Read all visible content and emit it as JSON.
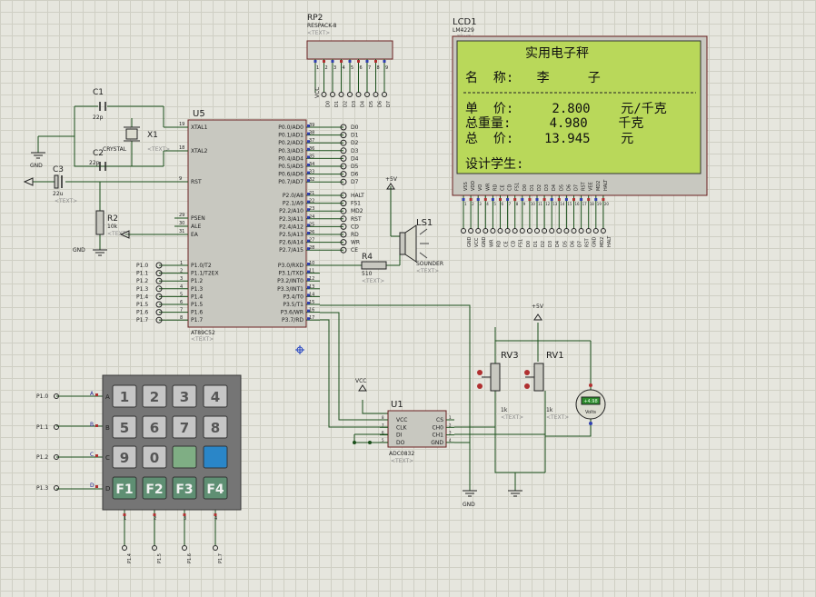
{
  "u5": {
    "ref": "U5",
    "part": "AT89C52",
    "text": "<TEXT>",
    "left_pins": [
      {
        "num": "19",
        "name": "XTAL1"
      },
      {
        "num": "18",
        "name": "XTAL2"
      },
      {
        "num": "9",
        "name": "RST"
      },
      {
        "num": "29",
        "name": "PSEN"
      },
      {
        "num": "30",
        "name": "ALE"
      },
      {
        "num": "31",
        "name": "EA"
      }
    ],
    "p1_pins": [
      {
        "num": "1",
        "name": "P1.0/T2",
        "net": "P1.0"
      },
      {
        "num": "2",
        "name": "P1.1/T2EX",
        "net": "P1.1"
      },
      {
        "num": "3",
        "name": "P1.2",
        "net": "P1.2"
      },
      {
        "num": "4",
        "name": "P1.3",
        "net": "P1.3"
      },
      {
        "num": "5",
        "name": "P1.4",
        "net": "P1.4"
      },
      {
        "num": "6",
        "name": "P1.5",
        "net": "P1.5"
      },
      {
        "num": "7",
        "name": "P1.6",
        "net": "P1.6"
      },
      {
        "num": "8",
        "name": "P1.7",
        "net": "P1.7"
      }
    ],
    "p0_pins": [
      {
        "num": "39",
        "name": "P0.0/AD0",
        "net": "D0"
      },
      {
        "num": "38",
        "name": "P0.1/AD1",
        "net": "D1"
      },
      {
        "num": "37",
        "name": "P0.2/AD2",
        "net": "D2"
      },
      {
        "num": "36",
        "name": "P0.3/AD3",
        "net": "D3"
      },
      {
        "num": "35",
        "name": "P0.4/AD4",
        "net": "D4"
      },
      {
        "num": "34",
        "name": "P0.5/AD5",
        "net": "D5"
      },
      {
        "num": "33",
        "name": "P0.6/AD6",
        "net": "D6"
      },
      {
        "num": "32",
        "name": "P0.7/AD7",
        "net": "D7"
      }
    ],
    "p2_pins": [
      {
        "num": "21",
        "name": "P2.0/A8",
        "net": "HALT"
      },
      {
        "num": "22",
        "name": "P2.1/A9",
        "net": "FS1"
      },
      {
        "num": "23",
        "name": "P2.2/A10",
        "net": "MD2"
      },
      {
        "num": "24",
        "name": "P2.3/A11",
        "net": "RST"
      },
      {
        "num": "25",
        "name": "P2.4/A12",
        "net": "CD"
      },
      {
        "num": "26",
        "name": "P2.5/A13",
        "net": "RD"
      },
      {
        "num": "27",
        "name": "P2.6/A14",
        "net": "WR"
      },
      {
        "num": "28",
        "name": "P2.7/A15",
        "net": "CE"
      }
    ],
    "p3_pins": [
      {
        "num": "10",
        "name": "P3.0/RXD"
      },
      {
        "num": "11",
        "name": "P3.1/TXD"
      },
      {
        "num": "12",
        "name": "P3.2/INT0"
      },
      {
        "num": "13",
        "name": "P3.3/INT1"
      },
      {
        "num": "14",
        "name": "P3.4/T0"
      },
      {
        "num": "15",
        "name": "P3.5/T1"
      },
      {
        "num": "16",
        "name": "P3.6/WR"
      },
      {
        "num": "17",
        "name": "P3.7/RD"
      }
    ]
  },
  "parts": {
    "c1": {
      "ref": "C1",
      "value": "22p"
    },
    "c2": {
      "ref": "C2",
      "value": "22p"
    },
    "c3": {
      "ref": "C3",
      "value": "22u"
    },
    "x1": {
      "ref": "X1",
      "value": "CRYSTAL",
      "text": "<TEXT>"
    },
    "r2": {
      "ref": "R2",
      "value": "10k",
      "text": "<TEXT>"
    },
    "r4": {
      "ref": "R4",
      "value": "510",
      "text": "<TEXT>"
    },
    "ls1": {
      "ref": "LS1",
      "value": "SOUNDER",
      "text": "<TEXT>"
    },
    "rp2": {
      "ref": "RP2",
      "value": "RESPACK-8",
      "text": "<TEXT>",
      "vcc": "VCC"
    },
    "u1": {
      "ref": "U1",
      "part": "ADC0832",
      "text": "<TEXT>",
      "left_pins": [
        "VCC",
        "CLK",
        "DI",
        "DO"
      ],
      "left_nums": [
        "8",
        "7",
        "6",
        "5"
      ],
      "right_pins": [
        "CS",
        "CH0",
        "CH1",
        "GND"
      ],
      "right_nums": [
        "1",
        "2",
        "3",
        "4"
      ]
    },
    "rv3": {
      "ref": "RV3",
      "value": "1k",
      "text": "<TEXT>"
    },
    "rv1": {
      "ref": "RV1",
      "value": "1k",
      "text": "<TEXT>"
    },
    "meter": {
      "reading": "+4.98",
      "unit": "Volts"
    },
    "gnd_labels": [
      "GND",
      "GND",
      "GND"
    ],
    "vcc_labels": [
      "+5V",
      "+5V",
      "VCC"
    ]
  },
  "rp2_pins": [
    "1",
    "2",
    "3",
    "4",
    "5",
    "6",
    "7",
    "8",
    "9"
  ],
  "rp2_nets": [
    "D0",
    "D1",
    "D2",
    "D3",
    "D4",
    "D5",
    "D6",
    "D7"
  ],
  "lcd": {
    "ref": "LCD1",
    "part": "LM4229",
    "text": "<TEXT>",
    "bg_color": "#b9d85a",
    "lines": [
      "实用电子秤",
      "名  称:   李     子",
      "单  价:     2.800    元/千克",
      "总重量:     4.980    千克",
      "总  价:    13.945    元",
      "设计学生:"
    ],
    "pins": [
      "VSS",
      "VDD",
      "VO",
      "WR",
      "RD",
      "CE",
      "CD",
      "FS1",
      "D0",
      "D1",
      "D2",
      "D3",
      "D4",
      "D5",
      "D6",
      "D7",
      "RST",
      "VEE",
      "MD2",
      "HALT"
    ],
    "pin_nums": [
      "1",
      "2",
      "3",
      "4",
      "5",
      "6",
      "7",
      "8",
      "9",
      "10",
      "11",
      "12",
      "13",
      "14",
      "15",
      "16",
      "17",
      "18",
      "19",
      "20"
    ],
    "nets": [
      "GND",
      "VCC",
      "GND",
      "WR",
      "RD",
      "CE",
      "CD",
      "FS1",
      "D0",
      "D1",
      "D2",
      "D3",
      "D4",
      "D5",
      "D6",
      "D7",
      "RST",
      "GND",
      "MD2",
      "HALT"
    ]
  },
  "keypad": {
    "row_nets": [
      "P1.0",
      "P1.1",
      "P1.2",
      "P1.3"
    ],
    "row_letters": [
      "A",
      "B",
      "C",
      "D"
    ],
    "col_nets": [
      "P1.4",
      "P1.5",
      "P1.6",
      "P1.7"
    ],
    "col_nums": [
      "1",
      "2",
      "3",
      "4"
    ],
    "keys": [
      [
        "1",
        "2",
        "3",
        "4"
      ],
      [
        "5",
        "6",
        "7",
        "8"
      ],
      [
        "9",
        "0",
        "",
        ""
      ],
      [
        "F1",
        "F2",
        "F3",
        "F4"
      ]
    ],
    "green_key_color": "#7fae84",
    "blue_key_color": "#2a86c8",
    "fkey_color": "#5f8f73"
  }
}
